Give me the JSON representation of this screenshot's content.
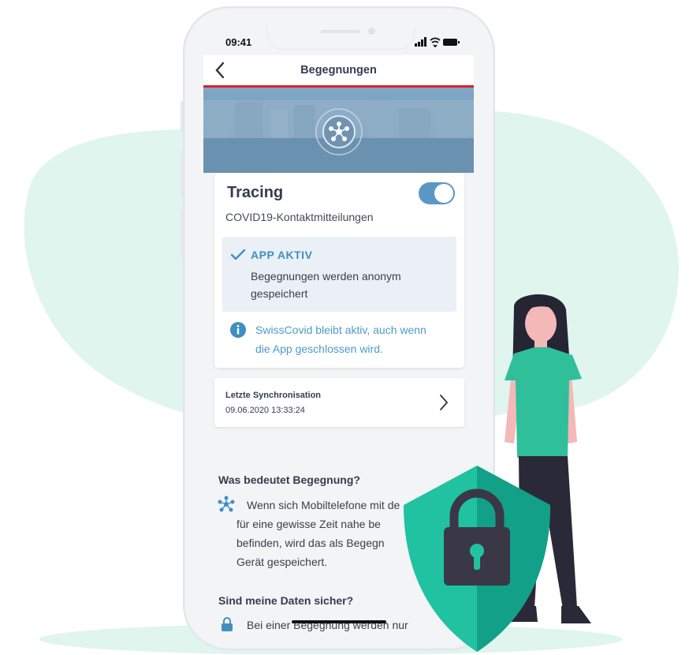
{
  "status_bar": {
    "time": "09:41",
    "icons": "▂▄▆ ◉ ▭"
  },
  "navbar": {
    "back_icon": "‹",
    "title": "Begegnungen"
  },
  "tracing_card": {
    "title": "Tracing",
    "subtitle": "COVID19-Kontaktmitteilungen",
    "toggle_on": true,
    "status_title": "APP AKTIV",
    "status_text_line1": "Begegnungen werden anonym",
    "status_text_line2": "gespeichert",
    "info_line1": "SwissCovid bleibt aktiv, auch wenn",
    "info_line2": "die App geschlossen wird."
  },
  "sync_card": {
    "label": "Letzte Synchronisation",
    "time": "09.06.2020 13:33:24"
  },
  "section1": {
    "title": "Was bedeutet Begegnung?",
    "line1": "Wenn sich Mobiltelefone mit de",
    "line2": "für eine gewisse Zeit nahe be",
    "line3": "befinden, wird das als Begegn",
    "line4": "Gerät gespeichert."
  },
  "section2": {
    "title": "Sind meine Daten sicher?",
    "line1": "Bei einer Begegnung werden nur"
  },
  "colors": {
    "accent_blue": "#5b97c4",
    "brand_red": "#d8232a",
    "shield_green": "#19b49a",
    "blob": "#dff5ee"
  },
  "icons": [
    "chevron-left-icon",
    "tracing-network-icon",
    "checkmark-icon",
    "info-icon",
    "chevron-right-icon",
    "encounter-icon",
    "lock-icon",
    "shield-lock-icon"
  ]
}
